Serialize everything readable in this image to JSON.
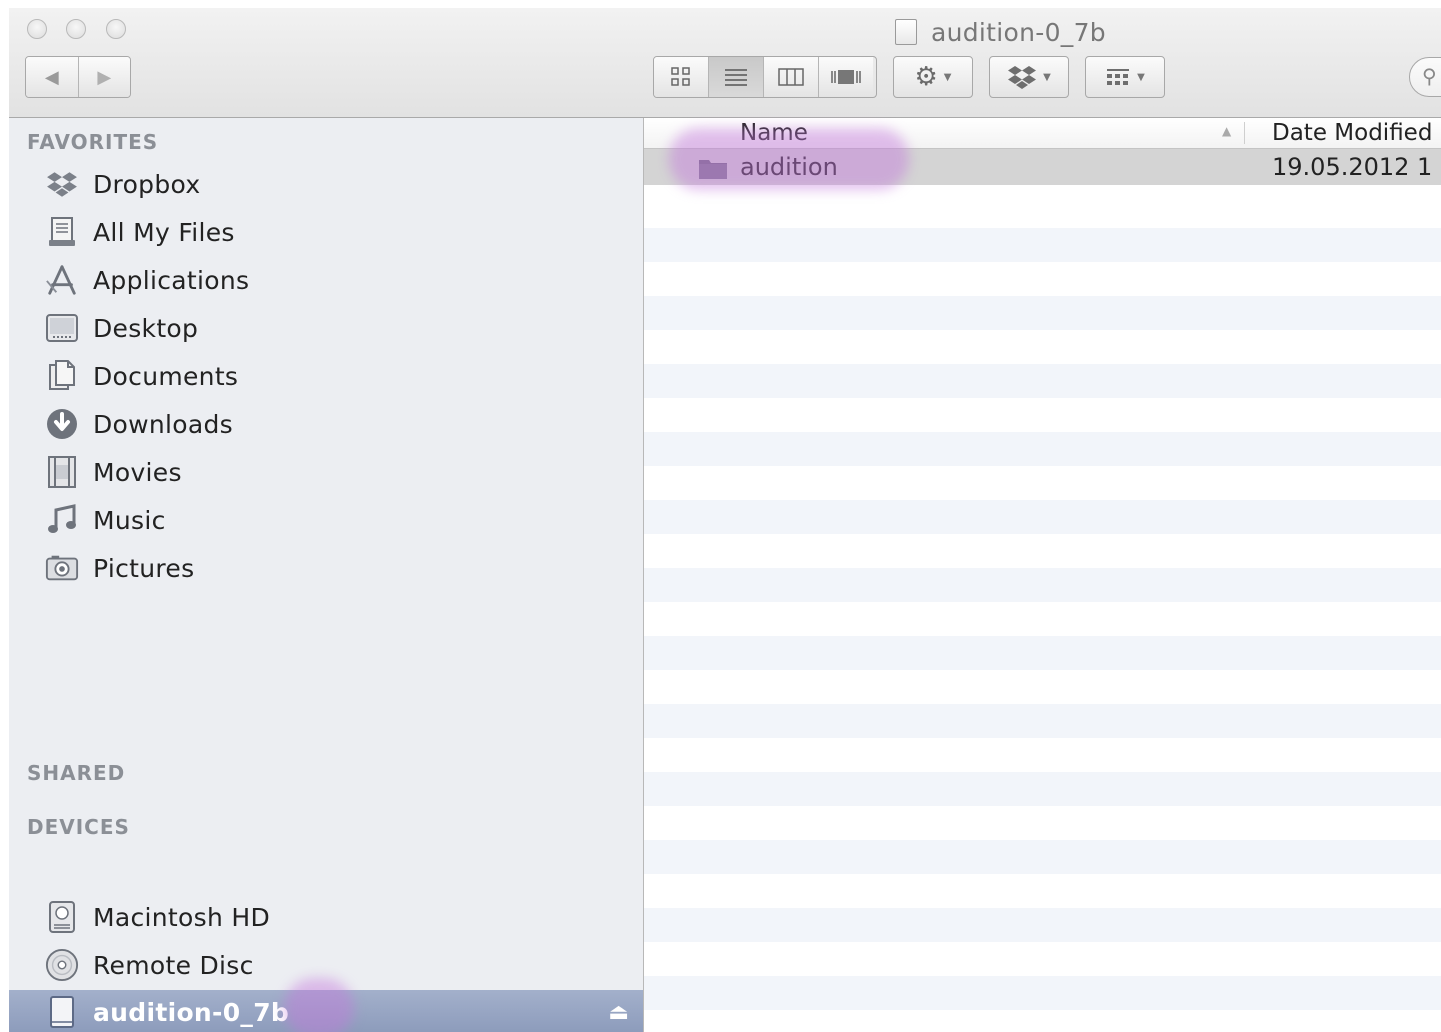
{
  "window": {
    "title": "audition-0_7b"
  },
  "toolbar": {
    "back_icon": "triangle-left",
    "forward_icon": "triangle-right",
    "view_modes": [
      "icon-view",
      "list-view",
      "column-view",
      "coverflow-view"
    ],
    "active_view": "list-view",
    "action_icon": "gear",
    "dropbox_icon": "dropbox",
    "arrange_icon": "grid-arrange",
    "search_icon": "magnifier"
  },
  "sidebar": {
    "favorites_header": "FAVORITES",
    "favorites": [
      {
        "label": "Dropbox",
        "icon": "dropbox-icon"
      },
      {
        "label": "All My Files",
        "icon": "all-files-icon"
      },
      {
        "label": "Applications",
        "icon": "applications-icon"
      },
      {
        "label": "Desktop",
        "icon": "desktop-icon"
      },
      {
        "label": "Documents",
        "icon": "documents-icon"
      },
      {
        "label": "Downloads",
        "icon": "downloads-icon"
      },
      {
        "label": "Movies",
        "icon": "movies-icon"
      },
      {
        "label": "Music",
        "icon": "music-icon"
      },
      {
        "label": "Pictures",
        "icon": "pictures-icon"
      }
    ],
    "shared_header": "SHARED",
    "devices_header": "DEVICES",
    "devices": [
      {
        "label": "Macintosh HD",
        "icon": "hard-drive-icon"
      },
      {
        "label": "Remote Disc",
        "icon": "disc-icon"
      },
      {
        "label": "audition-0_7b",
        "icon": "disk-image-icon",
        "selected": true
      }
    ]
  },
  "list": {
    "columns": {
      "name": "Name",
      "date_modified": "Date Modified"
    },
    "rows": [
      {
        "name": "audition",
        "date_modified": "19.05.2012 1",
        "selected": true
      }
    ]
  },
  "colors": {
    "sidebar_bg": "#eceef2",
    "selection": "#8c9bbb",
    "highlight_mark": "#c478dc"
  }
}
